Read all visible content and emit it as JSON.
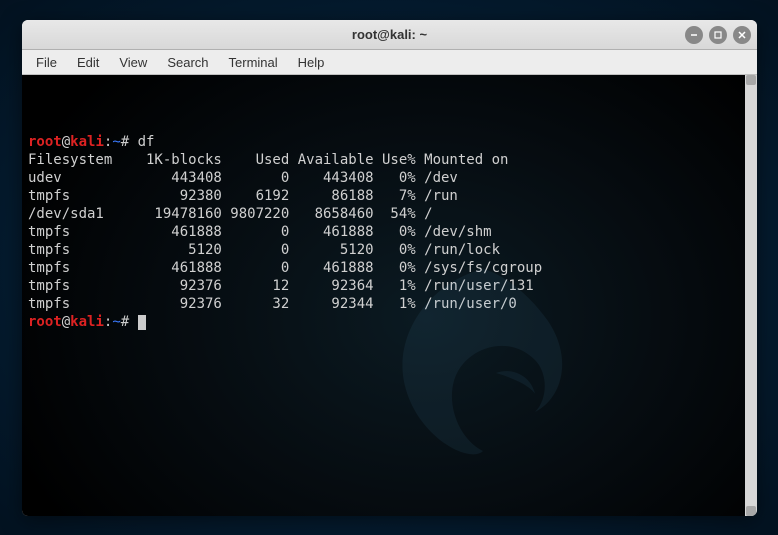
{
  "titlebar": {
    "title": "root@kali: ~"
  },
  "menubar": {
    "items": [
      "File",
      "Edit",
      "View",
      "Search",
      "Terminal",
      "Help"
    ]
  },
  "prompt": {
    "user": "root",
    "at": "@",
    "host": "kali",
    "colon": ":",
    "path": "~",
    "hash": "#"
  },
  "command": "df",
  "header": {
    "filesystem": "Filesystem",
    "blocks": "1K-blocks",
    "used": "Used",
    "available": "Available",
    "usepct": "Use%",
    "mounted": "Mounted on"
  },
  "rows": [
    {
      "fs": "udev",
      "blocks": "443408",
      "used": "0",
      "avail": "443408",
      "usepct": "0%",
      "mount": "/dev"
    },
    {
      "fs": "tmpfs",
      "blocks": "92380",
      "used": "6192",
      "avail": "86188",
      "usepct": "7%",
      "mount": "/run"
    },
    {
      "fs": "/dev/sda1",
      "blocks": "19478160",
      "used": "9807220",
      "avail": "8658460",
      "usepct": "54%",
      "mount": "/"
    },
    {
      "fs": "tmpfs",
      "blocks": "461888",
      "used": "0",
      "avail": "461888",
      "usepct": "0%",
      "mount": "/dev/shm"
    },
    {
      "fs": "tmpfs",
      "blocks": "5120",
      "used": "0",
      "avail": "5120",
      "usepct": "0%",
      "mount": "/run/lock"
    },
    {
      "fs": "tmpfs",
      "blocks": "461888",
      "used": "0",
      "avail": "461888",
      "usepct": "0%",
      "mount": "/sys/fs/cgroup"
    },
    {
      "fs": "tmpfs",
      "blocks": "92376",
      "used": "12",
      "avail": "92364",
      "usepct": "1%",
      "mount": "/run/user/131"
    },
    {
      "fs": "tmpfs",
      "blocks": "92376",
      "used": "32",
      "avail": "92344",
      "usepct": "1%",
      "mount": "/run/user/0"
    }
  ]
}
